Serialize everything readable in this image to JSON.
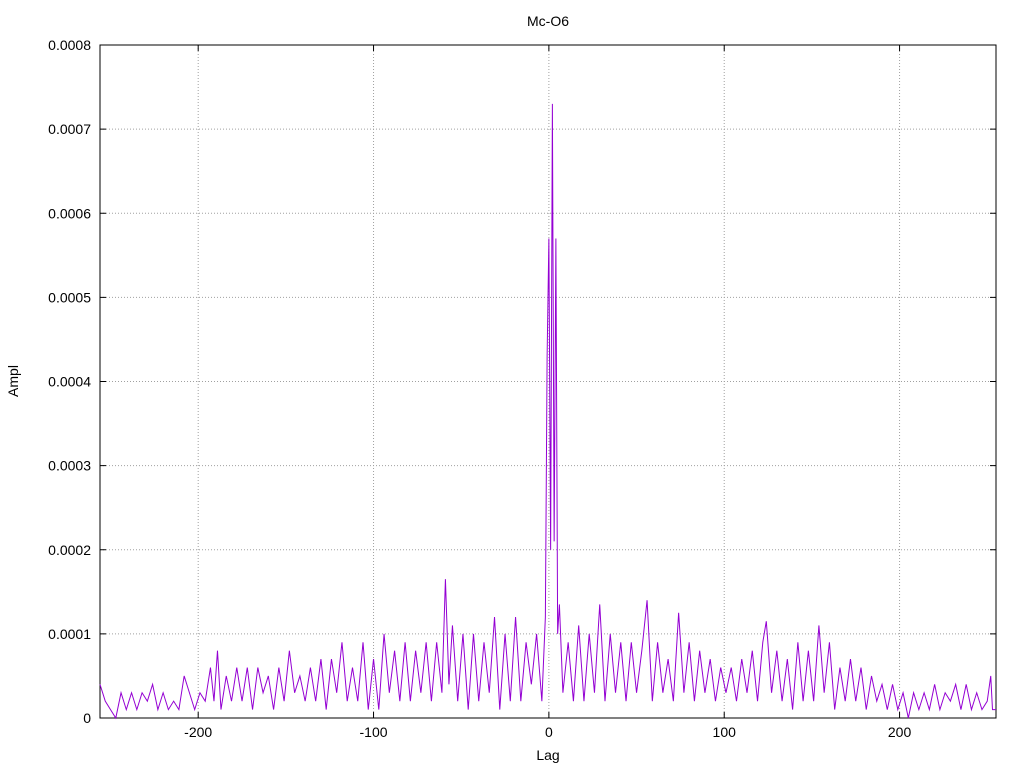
{
  "chart_data": {
    "type": "line",
    "title": "Mc-O6",
    "xlabel": "Lag",
    "ylabel": "Ampl",
    "xlim": [
      -256,
      255
    ],
    "ylim": [
      0,
      0.0008
    ],
    "x_ticks": [
      -200,
      -100,
      0,
      100,
      200
    ],
    "x_tick_labels": [
      "-200",
      "-100",
      "0",
      "100",
      "200"
    ],
    "y_ticks": [
      0,
      0.0001,
      0.0002,
      0.0003,
      0.0004,
      0.0005,
      0.0006,
      0.0007,
      0.0008
    ],
    "y_tick_labels": [
      "0",
      "0.0001",
      "0.0002",
      "0.0003",
      "0.0004",
      "0.0005",
      "0.0006",
      "0.0007",
      "0.0008"
    ],
    "grid": true,
    "series_color": "#9400d3",
    "series": [
      {
        "name": "",
        "points": [
          [
            -256,
            4e-05
          ],
          [
            -253,
            2e-05
          ],
          [
            -250,
            1e-05
          ],
          [
            -247,
            0.0
          ],
          [
            -244,
            3e-05
          ],
          [
            -241,
            1e-05
          ],
          [
            -238,
            3e-05
          ],
          [
            -235,
            1e-05
          ],
          [
            -232,
            3e-05
          ],
          [
            -229,
            2e-05
          ],
          [
            -226,
            4e-05
          ],
          [
            -223,
            1e-05
          ],
          [
            -220,
            3e-05
          ],
          [
            -217,
            1e-05
          ],
          [
            -214,
            2e-05
          ],
          [
            -211,
            1e-05
          ],
          [
            -208,
            5e-05
          ],
          [
            -205,
            3e-05
          ],
          [
            -202,
            1e-05
          ],
          [
            -199,
            3e-05
          ],
          [
            -196,
            2e-05
          ],
          [
            -193,
            6e-05
          ],
          [
            -191,
            2e-05
          ],
          [
            -189,
            8e-05
          ],
          [
            -187,
            1e-05
          ],
          [
            -184,
            5e-05
          ],
          [
            -181,
            2e-05
          ],
          [
            -178,
            6e-05
          ],
          [
            -175,
            2e-05
          ],
          [
            -172,
            6e-05
          ],
          [
            -169,
            1e-05
          ],
          [
            -166,
            6e-05
          ],
          [
            -163,
            3e-05
          ],
          [
            -160,
            5e-05
          ],
          [
            -157,
            1e-05
          ],
          [
            -154,
            6e-05
          ],
          [
            -151,
            2e-05
          ],
          [
            -148,
            8e-05
          ],
          [
            -145,
            3e-05
          ],
          [
            -142,
            5e-05
          ],
          [
            -139,
            2e-05
          ],
          [
            -136,
            6e-05
          ],
          [
            -133,
            2e-05
          ],
          [
            -130,
            7e-05
          ],
          [
            -127,
            1e-05
          ],
          [
            -124,
            7e-05
          ],
          [
            -121,
            3e-05
          ],
          [
            -118,
            9e-05
          ],
          [
            -115,
            2e-05
          ],
          [
            -112,
            6e-05
          ],
          [
            -109,
            2e-05
          ],
          [
            -106,
            9e-05
          ],
          [
            -103,
            1e-05
          ],
          [
            -100,
            7e-05
          ],
          [
            -97,
            1e-05
          ],
          [
            -94,
            0.0001
          ],
          [
            -91,
            3e-05
          ],
          [
            -88,
            8e-05
          ],
          [
            -85,
            2e-05
          ],
          [
            -82,
            9e-05
          ],
          [
            -79,
            2e-05
          ],
          [
            -76,
            8e-05
          ],
          [
            -73,
            3e-05
          ],
          [
            -70,
            9e-05
          ],
          [
            -67,
            2e-05
          ],
          [
            -64,
            9e-05
          ],
          [
            -61,
            3e-05
          ],
          [
            -59,
            0.000165
          ],
          [
            -57,
            4e-05
          ],
          [
            -55,
            0.00011
          ],
          [
            -52,
            2e-05
          ],
          [
            -49,
            0.0001
          ],
          [
            -46,
            1e-05
          ],
          [
            -43,
            0.0001
          ],
          [
            -40,
            2e-05
          ],
          [
            -37,
            9e-05
          ],
          [
            -34,
            3e-05
          ],
          [
            -31,
            0.00012
          ],
          [
            -28,
            1e-05
          ],
          [
            -25,
            0.0001
          ],
          [
            -22,
            2e-05
          ],
          [
            -19,
            0.00012
          ],
          [
            -16,
            2e-05
          ],
          [
            -13,
            9e-05
          ],
          [
            -10,
            4e-05
          ],
          [
            -7,
            0.0001
          ],
          [
            -4,
            2e-05
          ],
          [
            -2,
            0.00012
          ],
          [
            -1,
            0.00043
          ],
          [
            0,
            0.00057
          ],
          [
            1,
            0.0002
          ],
          [
            2,
            0.00073
          ],
          [
            3,
            0.00021
          ],
          [
            4,
            0.00057
          ],
          [
            5,
            0.0001
          ],
          [
            6,
            0.000135
          ],
          [
            8,
            3e-05
          ],
          [
            11,
            9e-05
          ],
          [
            14,
            2e-05
          ],
          [
            17,
            0.00011
          ],
          [
            20,
            2e-05
          ],
          [
            23,
            0.0001
          ],
          [
            26,
            3e-05
          ],
          [
            29,
            0.000135
          ],
          [
            32,
            2e-05
          ],
          [
            35,
            0.0001
          ],
          [
            38,
            3e-05
          ],
          [
            41,
            9e-05
          ],
          [
            44,
            2e-05
          ],
          [
            47,
            9e-05
          ],
          [
            50,
            3e-05
          ],
          [
            53,
            8e-05
          ],
          [
            56,
            0.00014
          ],
          [
            59,
            2e-05
          ],
          [
            62,
            9e-05
          ],
          [
            65,
            3e-05
          ],
          [
            68,
            7e-05
          ],
          [
            71,
            2e-05
          ],
          [
            74,
            0.000125
          ],
          [
            77,
            3e-05
          ],
          [
            80,
            9e-05
          ],
          [
            83,
            2e-05
          ],
          [
            86,
            8e-05
          ],
          [
            89,
            3e-05
          ],
          [
            92,
            7e-05
          ],
          [
            95,
            2e-05
          ],
          [
            98,
            6e-05
          ],
          [
            101,
            3e-05
          ],
          [
            104,
            6e-05
          ],
          [
            107,
            2e-05
          ],
          [
            110,
            7e-05
          ],
          [
            113,
            3e-05
          ],
          [
            116,
            8e-05
          ],
          [
            119,
            2e-05
          ],
          [
            122,
            9e-05
          ],
          [
            124,
            0.000115
          ],
          [
            127,
            3e-05
          ],
          [
            130,
            8e-05
          ],
          [
            133,
            2e-05
          ],
          [
            136,
            7e-05
          ],
          [
            139,
            1e-05
          ],
          [
            142,
            9e-05
          ],
          [
            145,
            2e-05
          ],
          [
            148,
            8e-05
          ],
          [
            151,
            2e-05
          ],
          [
            154,
            0.00011
          ],
          [
            157,
            3e-05
          ],
          [
            160,
            9e-05
          ],
          [
            163,
            1e-05
          ],
          [
            166,
            6e-05
          ],
          [
            169,
            2e-05
          ],
          [
            172,
            7e-05
          ],
          [
            175,
            2e-05
          ],
          [
            178,
            6e-05
          ],
          [
            181,
            1e-05
          ],
          [
            184,
            5e-05
          ],
          [
            187,
            2e-05
          ],
          [
            190,
            4e-05
          ],
          [
            193,
            1e-05
          ],
          [
            196,
            4e-05
          ],
          [
            199,
            1e-05
          ],
          [
            202,
            3e-05
          ],
          [
            205,
            0.0
          ],
          [
            208,
            3e-05
          ],
          [
            211,
            1e-05
          ],
          [
            214,
            3e-05
          ],
          [
            217,
            1e-05
          ],
          [
            220,
            4e-05
          ],
          [
            223,
            1e-05
          ],
          [
            226,
            3e-05
          ],
          [
            229,
            2e-05
          ],
          [
            232,
            4e-05
          ],
          [
            235,
            1e-05
          ],
          [
            238,
            4e-05
          ],
          [
            241,
            1e-05
          ],
          [
            244,
            3e-05
          ],
          [
            247,
            1e-05
          ],
          [
            250,
            2e-05
          ],
          [
            252,
            5e-05
          ],
          [
            253,
            1e-05
          ],
          [
            255,
            1e-05
          ]
        ]
      }
    ]
  }
}
